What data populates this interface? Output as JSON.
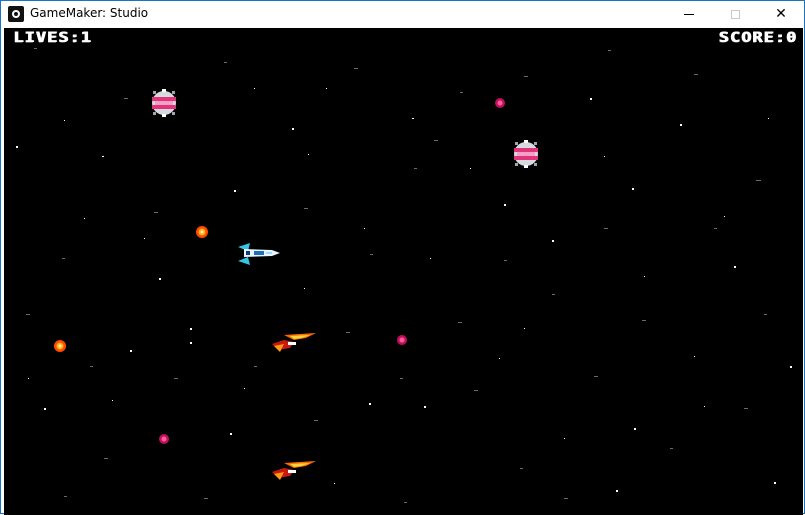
{
  "window": {
    "title": "GameMaker: Studio",
    "minimize_glyph": "",
    "close_glyph": "✕"
  },
  "hud": {
    "lives_text": "LIVES:1",
    "score_text": "SCORE:0"
  },
  "sprites": {
    "player_ship": "player-ship",
    "pink_drone": "pink-drone-enemy",
    "flame_fighter": "flame-fighter-enemy",
    "orange_shot": "orange-bullet",
    "pink_shot": "pink-bullet"
  },
  "colors": {
    "space": "#000000",
    "window_border": "#1e73be",
    "drone_pink": "#e0357a",
    "shot_orange": "#ff8a00",
    "shot_pink": "#e0206a",
    "ship_cyan": "#33c6e8"
  }
}
